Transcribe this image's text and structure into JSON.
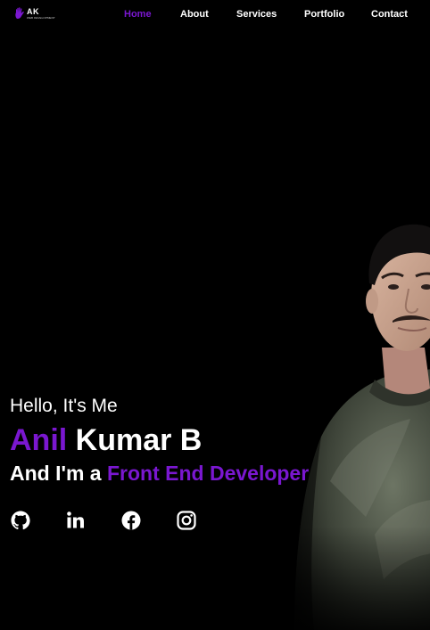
{
  "brand": {
    "mark": "AK",
    "subtitle": "WEB DEVELOPMENT",
    "icon": "hand-logo-icon"
  },
  "nav": {
    "items": [
      {
        "label": "Home",
        "active": true
      },
      {
        "label": "About",
        "active": false
      },
      {
        "label": "Services",
        "active": false
      },
      {
        "label": "Portfolio",
        "active": false
      },
      {
        "label": "Contact",
        "active": false
      }
    ]
  },
  "hero": {
    "greeting": "Hello, It's Me",
    "name_first": "Anil",
    "name_rest": " Kumar B",
    "role_prefix": "And I'm a ",
    "role_highlight": "Front End Developer"
  },
  "socials": [
    {
      "name": "github-icon"
    },
    {
      "name": "linkedin-icon"
    },
    {
      "name": "facebook-icon"
    },
    {
      "name": "instagram-icon"
    }
  ],
  "colors": {
    "accent": "#7a17d0",
    "background": "#000000",
    "text": "#ffffff"
  }
}
